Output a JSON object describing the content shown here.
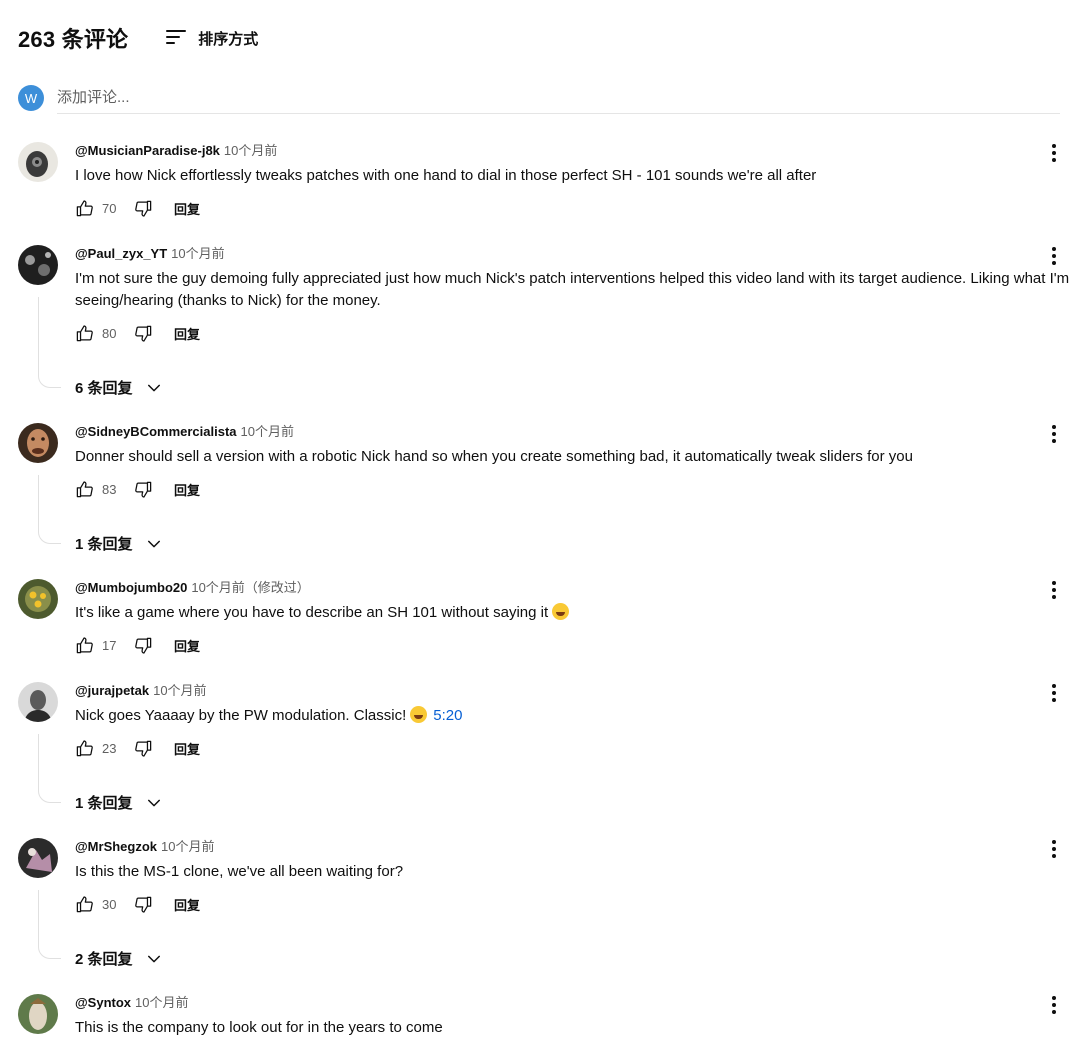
{
  "header": {
    "count_label": "263 条评论",
    "sort_label": "排序方式"
  },
  "add_comment": {
    "avatar_letter": "W",
    "placeholder": "添加评论..."
  },
  "reply_label": "回复",
  "comments": [
    {
      "author": "@MusicianParadise-j8k",
      "time": "10个月前",
      "text": "I love how Nick effortlessly tweaks patches with one hand to dial in those perfect SH - 101 sounds we're all after",
      "likes": "70"
    },
    {
      "author": "@Paul_zyx_YT",
      "time": "10个月前",
      "text": "I'm not sure the guy demoing fully appreciated just how much Nick's patch interventions helped this video land with its target audience. Liking what I'm seeing/hearing (thanks to Nick) for the money.",
      "likes": "80",
      "replies": "6 条回复"
    },
    {
      "author": "@SidneyBCommercialista",
      "time": "10个月前",
      "text": "Donner should sell a version with a robotic Nick hand so when you create something bad, it automatically tweak sliders for you",
      "likes": "83",
      "replies": "1 条回复"
    },
    {
      "author": "@Mumbojumbo20",
      "time": "10个月前（修改过）",
      "text": "It's like a game where you have to describe an SH 101 without saying it",
      "likes": "17"
    },
    {
      "author": "@jurajpetak",
      "time": "10个月前",
      "text": "Nick goes Yaaaay by the PW modulation. Classic!",
      "timestamp_link": "5:20",
      "likes": "23",
      "replies": "1 条回复"
    },
    {
      "author": "@MrShegzok",
      "time": "10个月前",
      "text": "Is this the MS-1 clone, we've all been waiting for?",
      "likes": "30",
      "replies": "2 条回复"
    },
    {
      "author": "@Syntox",
      "time": "10个月前",
      "text": "This is the company to look out for in the years to come"
    }
  ],
  "icons": {
    "sort": "sort-icon",
    "like": "thumbs-up-icon",
    "dislike": "thumbs-down-icon",
    "more": "more-vert-icon",
    "expand": "chevron-down-icon",
    "emoji": "laughing-emoji-icon"
  },
  "colors": {
    "link": "#065fd4",
    "my_avatar": "#3d8fd9",
    "secondary_text": "#606060"
  }
}
